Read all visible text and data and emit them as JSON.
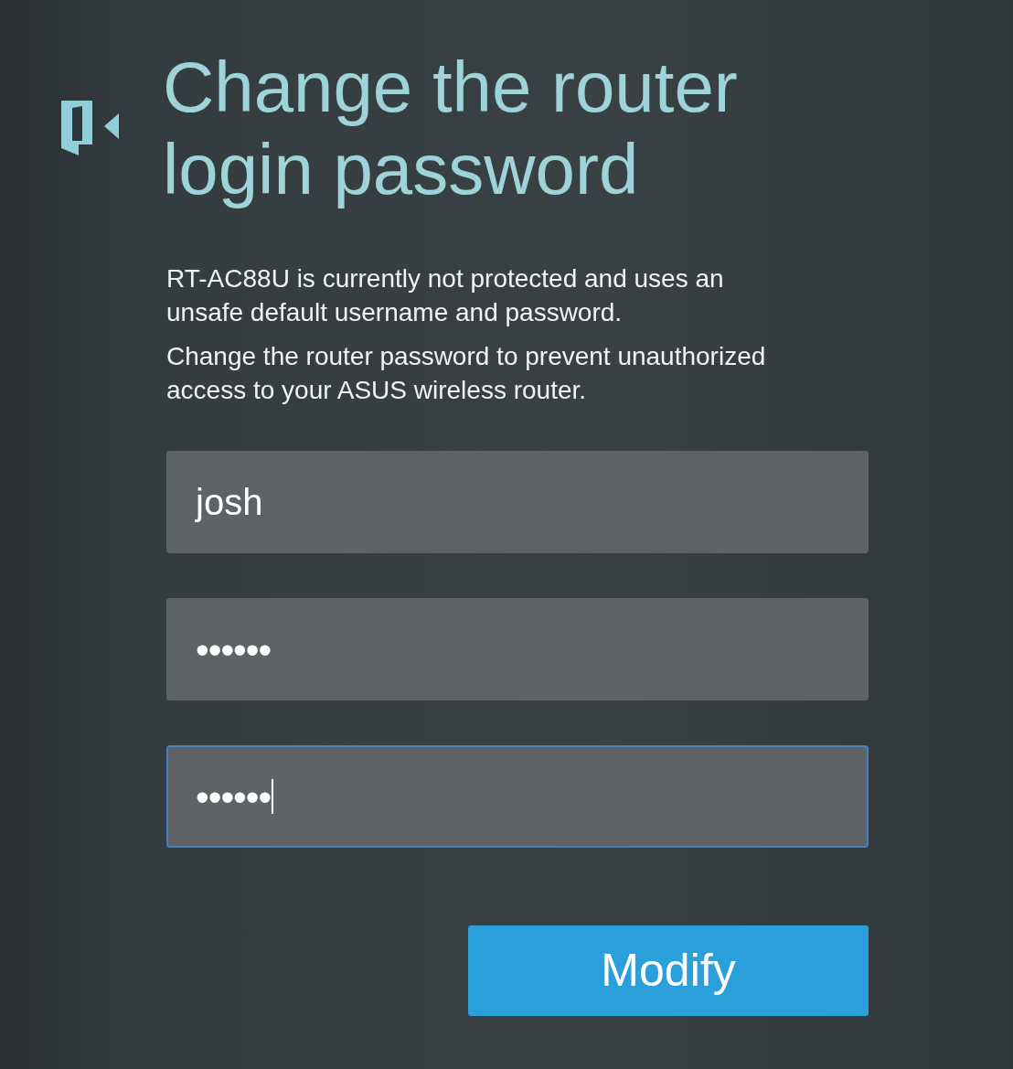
{
  "header": {
    "title": "Change the router login password"
  },
  "message": [
    "RT-AC88U is currently not protected and uses an unsafe default username and password.",
    "Change the router password to prevent unauthorized access to your ASUS wireless router."
  ],
  "fields": [
    {
      "kind": "text",
      "value": "josh",
      "focused": false
    },
    {
      "kind": "password",
      "value": "••••••",
      "focused": false
    },
    {
      "kind": "password",
      "value": "••••••",
      "focused": true
    }
  ],
  "buttons": [
    {
      "label": "Modify"
    }
  ]
}
